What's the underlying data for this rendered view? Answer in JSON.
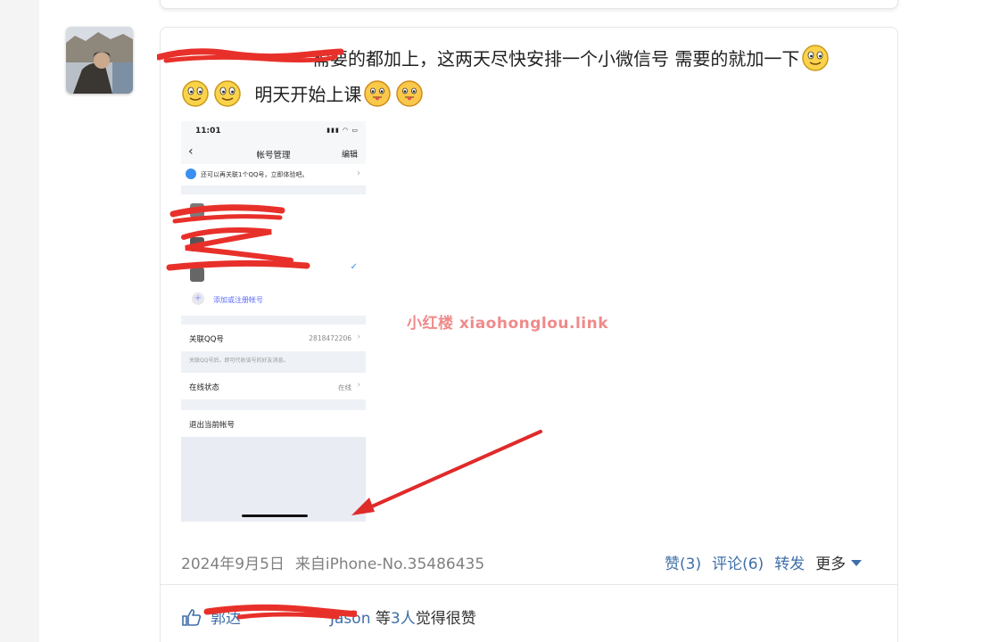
{
  "post": {
    "text_line1_visible": "需要的都加上，这两天尽快安排一个小微信号 需要的就加一下",
    "text_line2_visible": "明天开始上课",
    "date": "2024年9月5日",
    "source": "来自iPhone-No.35486435",
    "watermark": "小红楼  xiaohonglou.link"
  },
  "actions": {
    "like": "赞(3)",
    "comment": "评论(6)",
    "share": "转发",
    "more": "更多"
  },
  "likes": {
    "name1": "郭达",
    "name2": "Jason",
    "prefix": "等",
    "count": "3人",
    "suffix": "觉得很赞"
  },
  "phone": {
    "time": "11:01",
    "title": "帐号管理",
    "edit": "编辑",
    "banner": "还可以再关联1个QQ号，立即体验吧。",
    "add_account": "添加或注册帐号",
    "linked_qq_label": "关联QQ号",
    "linked_qq_value": "2818472206",
    "hint": "关联QQ号后，即可代收该号的好友消息。",
    "online_label": "在线状态",
    "online_value": "在线",
    "logout": "退出当前帐号"
  },
  "colors": {
    "link": "#3f6fa8",
    "meta": "#808080",
    "watermark": "#f08a8a",
    "redaction": "#e8302a"
  }
}
